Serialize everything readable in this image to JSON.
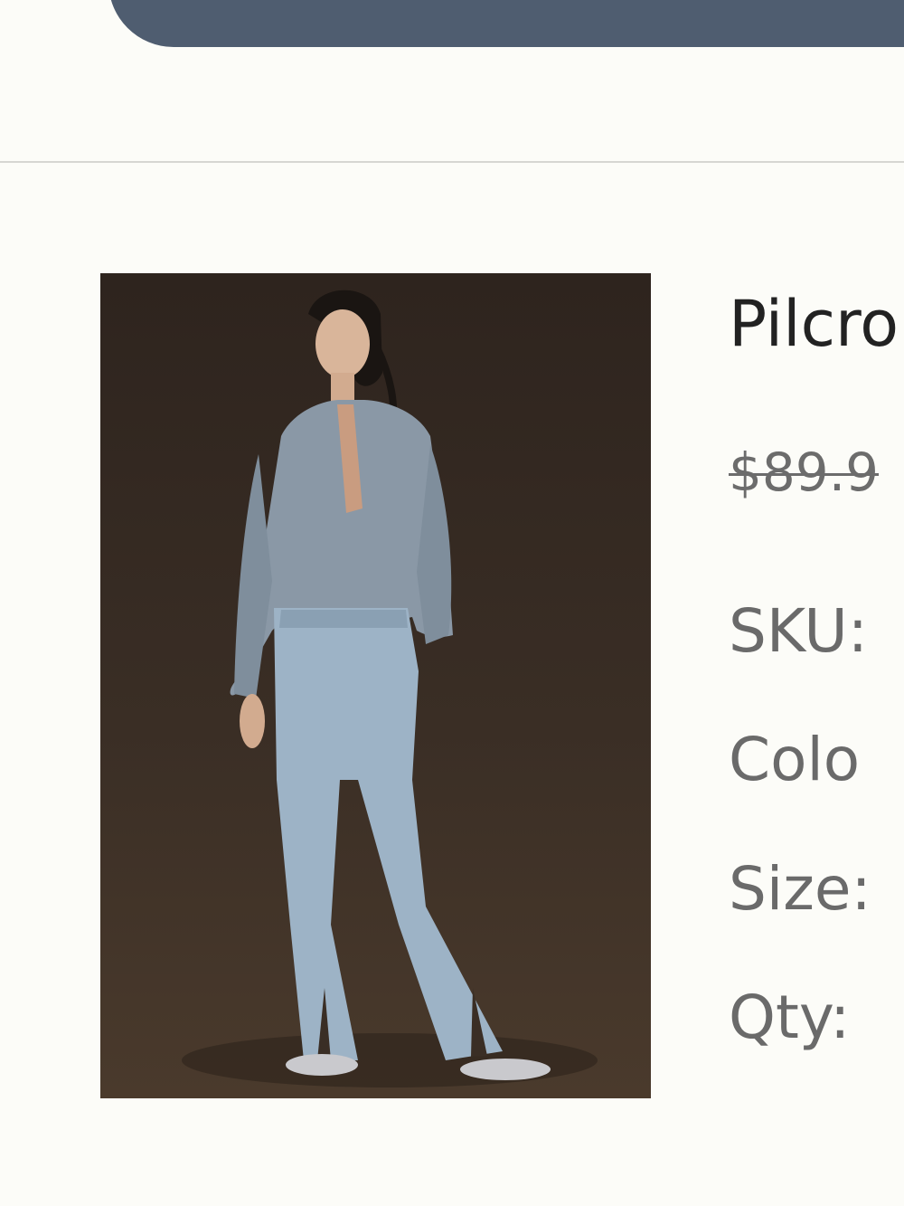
{
  "product": {
    "title": "Pilcro",
    "price_original": "$89.9",
    "image_alt": "product-photo"
  },
  "specs": {
    "sku_label": "SKU:",
    "color_label": "Colo",
    "size_label": "Size:",
    "qty_label": "Qty:"
  },
  "colors": {
    "header_bar": "#4f5d70",
    "background": "#fcfcf8"
  }
}
